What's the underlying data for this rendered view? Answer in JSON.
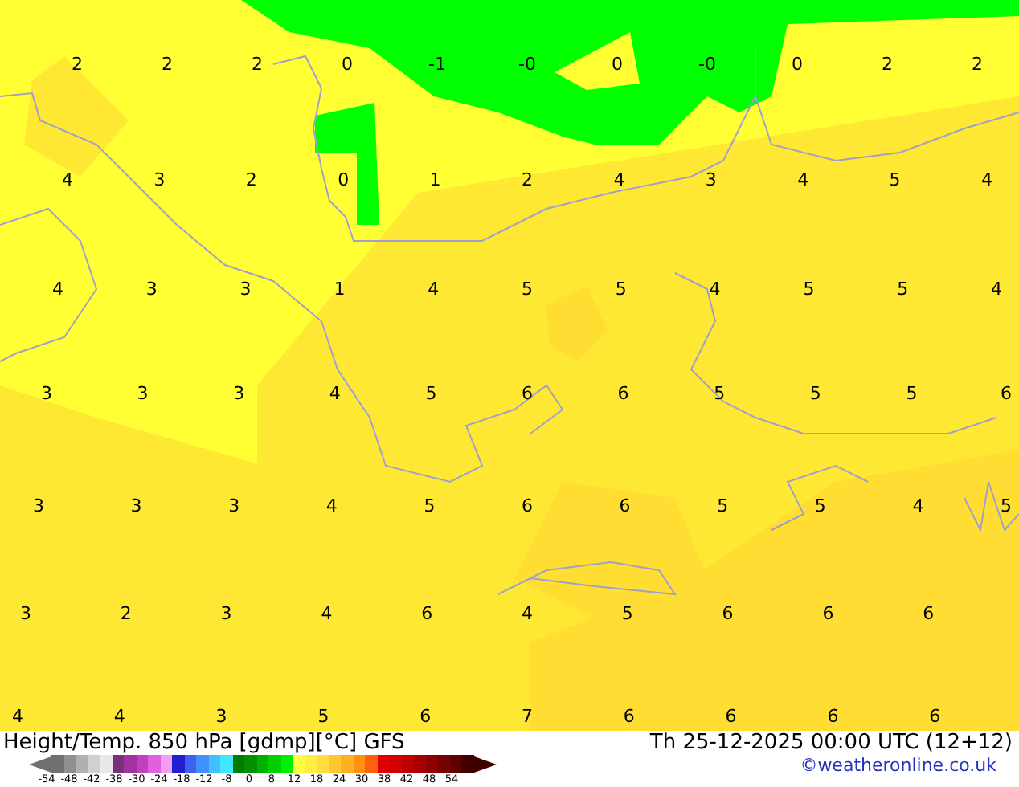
{
  "map": {
    "label_rows": [
      [
        "2",
        "2",
        "2",
        "0",
        "-1",
        "-0",
        "0",
        "-0",
        "0",
        "2",
        "2"
      ],
      [
        "4",
        "3",
        "2",
        "0",
        "1",
        "2",
        "4",
        "3",
        "4",
        "5",
        "4"
      ],
      [
        "4",
        "3",
        "3",
        "1",
        "4",
        "5",
        "5",
        "4",
        "5",
        "5",
        "4"
      ],
      [
        "3",
        "3",
        "3",
        "4",
        "5",
        "6",
        "6",
        "5",
        "5",
        "5",
        "6"
      ],
      [
        "3",
        "3",
        "3",
        "4",
        "5",
        "6",
        "6",
        "5",
        "5",
        "4",
        "5"
      ],
      [
        "3",
        "2",
        "3",
        "4",
        "6",
        "4",
        "5",
        "6",
        "6",
        "6"
      ],
      [
        "4",
        "4",
        "3",
        "5",
        "6",
        "7",
        "6",
        "6",
        "6",
        "6"
      ]
    ]
  },
  "footer": {
    "title": "Height/Temp. 850 hPa [gdmp][°C] GFS",
    "datetime": "Th 25-12-2025 00:00 UTC (12+12)",
    "credit": "©weatheronline.co.uk",
    "colorbar": [
      {
        "color": "#707070"
      },
      {
        "color": "#909090"
      },
      {
        "color": "#b0b0b0"
      },
      {
        "color": "#d0d0d0"
      },
      {
        "color": "#e8e8e8"
      },
      {
        "color": "#7a2f7a"
      },
      {
        "color": "#a033a0"
      },
      {
        "color": "#c040c0"
      },
      {
        "color": "#e060e0"
      },
      {
        "color": "#f0a0f0"
      },
      {
        "color": "#2020d0"
      },
      {
        "color": "#4060f0"
      },
      {
        "color": "#4090ff"
      },
      {
        "color": "#40c0ff"
      },
      {
        "color": "#40e8ff"
      },
      {
        "color": "#007a00"
      },
      {
        "color": "#009000"
      },
      {
        "color": "#00b000"
      },
      {
        "color": "#00d000"
      },
      {
        "color": "#00f000"
      },
      {
        "color": "#ffff40"
      },
      {
        "color": "#ffee40"
      },
      {
        "color": "#ffdd40"
      },
      {
        "color": "#ffc830"
      },
      {
        "color": "#ffb020"
      },
      {
        "color": "#ff9010"
      },
      {
        "color": "#ff6010"
      },
      {
        "color": "#e00000"
      },
      {
        "color": "#d00000"
      },
      {
        "color": "#c00000"
      },
      {
        "color": "#a80000"
      },
      {
        "color": "#900000"
      },
      {
        "color": "#780000"
      },
      {
        "color": "#600000"
      },
      {
        "color": "#400000"
      }
    ],
    "ticks": [
      "-54",
      "-48",
      "-42",
      "-38",
      "-30",
      "-24",
      "-18",
      "-12",
      "-8",
      "0",
      "8",
      "12",
      "18",
      "24",
      "30",
      "38",
      "42",
      "48",
      "54"
    ]
  }
}
